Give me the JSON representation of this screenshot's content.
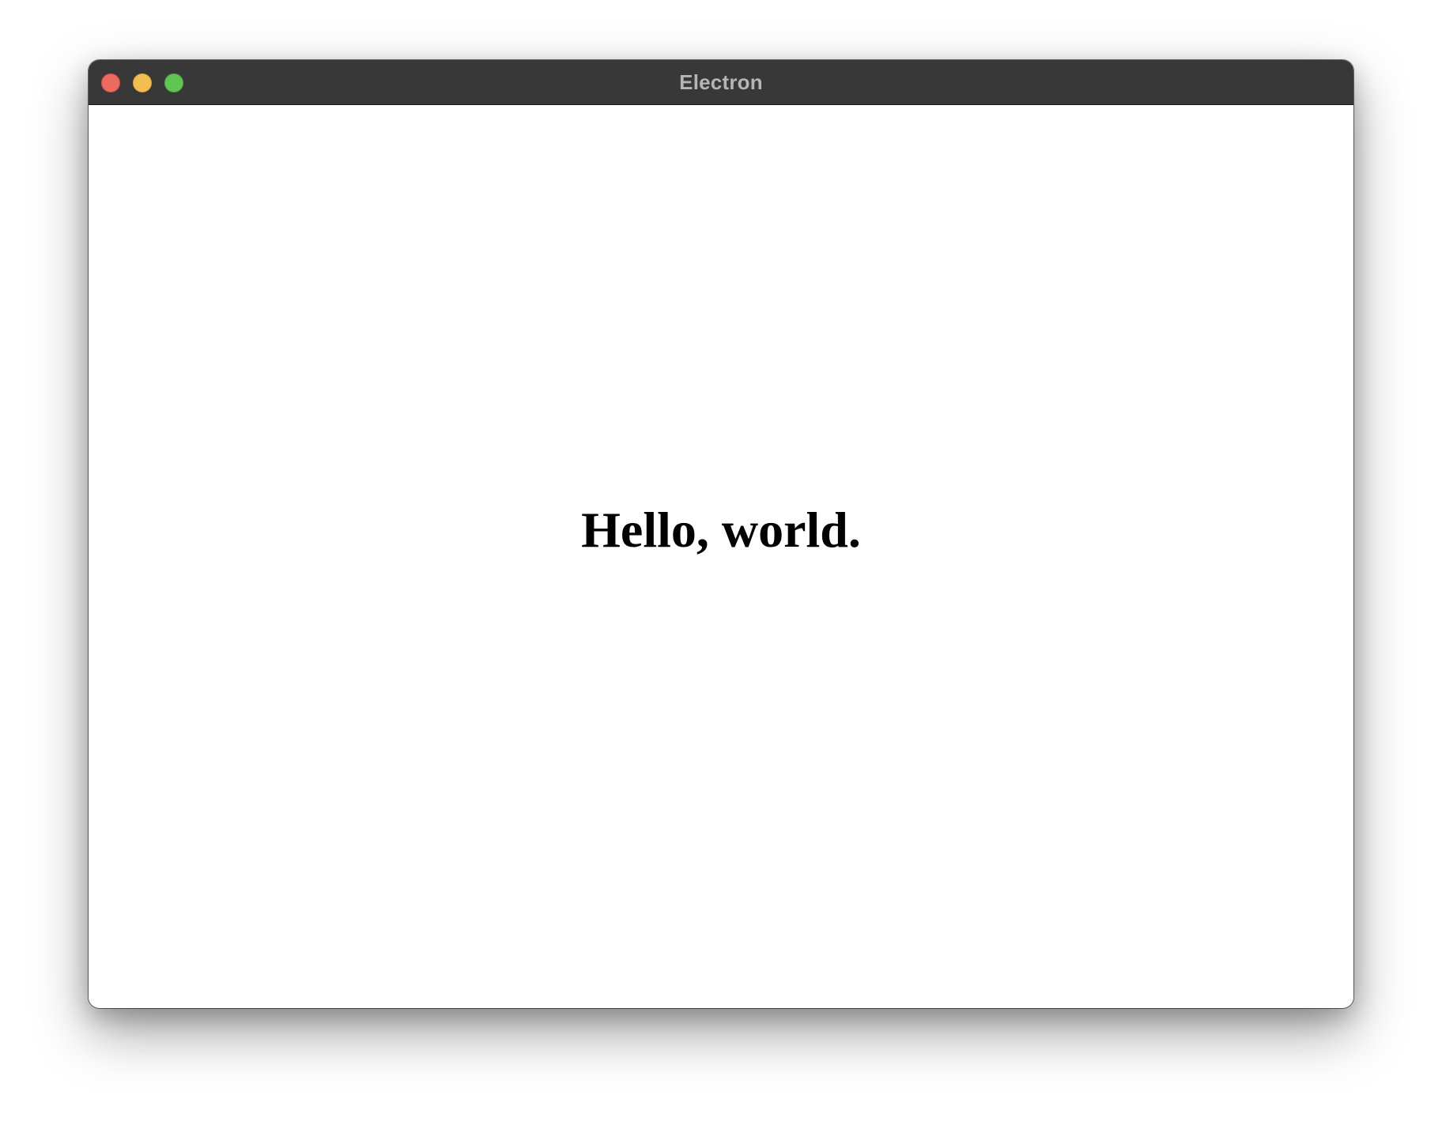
{
  "window": {
    "title": "Electron",
    "controls": {
      "close_color": "#ec6a5e",
      "minimize_color": "#f4be4f",
      "zoom_color": "#61c554"
    }
  },
  "content": {
    "heading": "Hello, world."
  }
}
